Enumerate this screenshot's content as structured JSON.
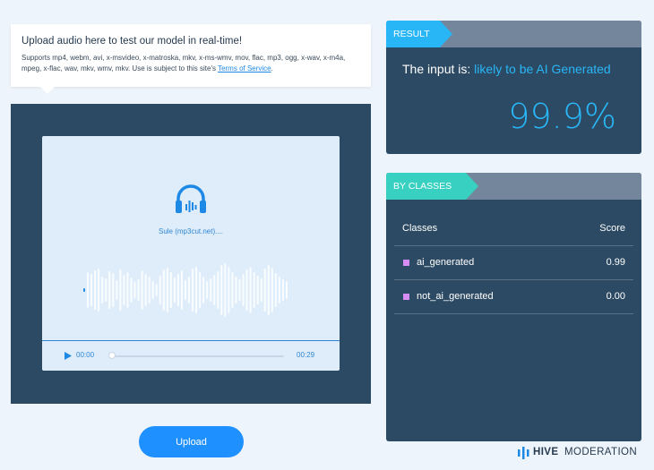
{
  "upload_info": {
    "title": "Upload audio here to test our model in real-time!",
    "description": "Supports mp4, webm, avi, x-msvideo, x-matroska, mkv, x-ms-wmv, mov, flac, mp3, ogg, x-wav, x-m4a, mpeg, x-flac, wav, mkv, wmv, mkv. Use is subject to this site's ",
    "terms_link": "Terms of Service",
    "terms_end": "."
  },
  "player": {
    "icon": "headphones-icon",
    "track_name": "Sule (mp3cut.net)....",
    "current_time": "00:00",
    "total_time": "00:29",
    "progress": 0
  },
  "upload_button": "Upload",
  "result": {
    "tag": "RESULT",
    "prefix": "The input is: ",
    "verdict": "likely to be AI Generated",
    "score": "99.9%"
  },
  "classes": {
    "tag": "BY CLASSES",
    "header": {
      "class": "Classes",
      "score": "Score"
    },
    "rows": [
      {
        "label": "ai_generated",
        "score": "0.99"
      },
      {
        "label": "not_ai_generated",
        "score": "0.00"
      }
    ]
  },
  "brand": {
    "name": "HIVE",
    "sub": "MODERATION"
  },
  "colors": {
    "accent": "#29b6f6",
    "panel": "#2c4a63",
    "classes_tag": "#38d0c0",
    "legend": "#d68cf2",
    "button": "#1e90ff"
  }
}
